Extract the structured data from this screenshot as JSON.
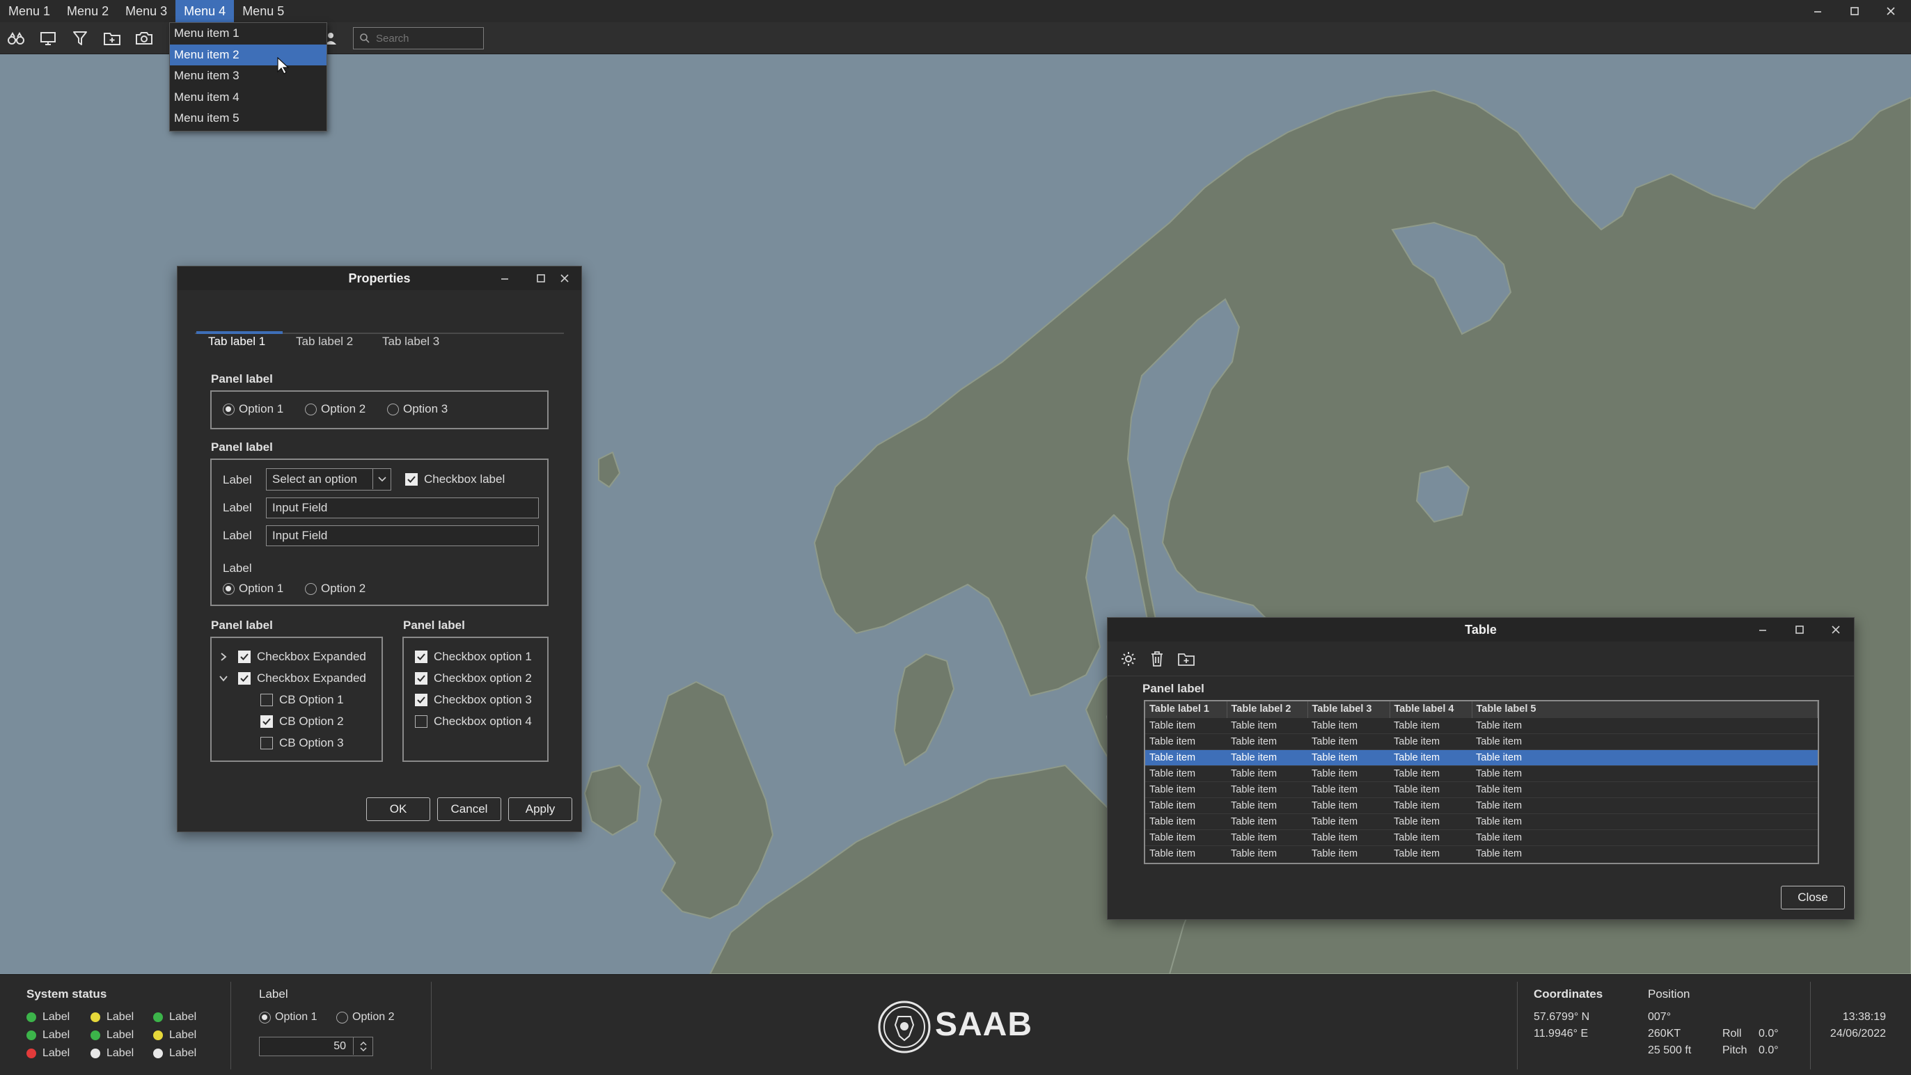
{
  "menubar": {
    "items": [
      "Menu 1",
      "Menu 2",
      "Menu 3",
      "Menu 4",
      "Menu 5"
    ],
    "active_index": 3
  },
  "toolbar": {
    "icons": [
      "binoculars-icon",
      "monitor-icon",
      "filter-icon",
      "folder-add-icon",
      "camera-icon"
    ],
    "search_placeholder": "Search"
  },
  "dropdown": {
    "items": [
      "Menu item 1",
      "Menu item 2",
      "Menu item 3",
      "Menu item 4",
      "Menu item 5"
    ],
    "highlighted_index": 1
  },
  "properties": {
    "title": "Properties",
    "tabs": [
      "Tab label 1",
      "Tab label 2",
      "Tab label 3"
    ],
    "active_tab": 0,
    "panel1": {
      "label": "Panel label",
      "options": [
        "Option 1",
        "Option 2",
        "Option 3"
      ],
      "selected": 0
    },
    "panel2": {
      "label": "Panel label",
      "row1_label": "Label",
      "select_value": "Select an option",
      "checkbox_label": "Checkbox label",
      "row2_label": "Label",
      "input1_value": "Input Field",
      "row3_label": "Label",
      "input2_value": "Input Field",
      "radio_label": "Label",
      "radio_options": [
        "Option 1",
        "Option 2"
      ],
      "radio_selected": 0
    },
    "panel3": {
      "label": "Panel label",
      "tree": [
        {
          "label": "Checkbox Expanded",
          "checked": true,
          "expanded": false
        },
        {
          "label": "Checkbox Expanded",
          "checked": true,
          "expanded": true
        }
      ],
      "children": [
        {
          "label": "CB Option 1",
          "checked": false
        },
        {
          "label": "CB Option 2",
          "checked": true
        },
        {
          "label": "CB Option 3",
          "checked": false
        }
      ]
    },
    "panel4": {
      "label": "Panel label",
      "options": [
        {
          "label": "Checkbox option 1",
          "checked": true
        },
        {
          "label": "Checkbox option 2",
          "checked": true
        },
        {
          "label": "Checkbox option 3",
          "checked": true
        },
        {
          "label": "Checkbox option 4",
          "checked": false
        }
      ]
    },
    "buttons": {
      "ok": "OK",
      "cancel": "Cancel",
      "apply": "Apply"
    }
  },
  "table_window": {
    "title": "Table",
    "panel_label": "Panel label",
    "columns": [
      "Table label 1",
      "Table label 2",
      "Table label 3",
      "Table label 4",
      "Table label 5"
    ],
    "rows": [
      [
        "Table item",
        "Table item",
        "Table item",
        "Table item",
        "Table item"
      ],
      [
        "Table item",
        "Table item",
        "Table item",
        "Table item",
        "Table item"
      ],
      [
        "Table item",
        "Table item",
        "Table item",
        "Table item",
        "Table item"
      ],
      [
        "Table item",
        "Table item",
        "Table item",
        "Table item",
        "Table item"
      ],
      [
        "Table item",
        "Table item",
        "Table item",
        "Table item",
        "Table item"
      ],
      [
        "Table item",
        "Table item",
        "Table item",
        "Table item",
        "Table item"
      ],
      [
        "Table item",
        "Table item",
        "Table item",
        "Table item",
        "Table item"
      ],
      [
        "Table item",
        "Table item",
        "Table item",
        "Table item",
        "Table item"
      ],
      [
        "Table item",
        "Table item",
        "Table item",
        "Table item",
        "Table item"
      ]
    ],
    "selected_row": 2,
    "close_label": "Close"
  },
  "statusbar": {
    "system_status_title": "System status",
    "status_items": [
      {
        "label": "Label",
        "color": "#3cb44a"
      },
      {
        "label": "Label",
        "color": "#3cb44a"
      },
      {
        "label": "Label",
        "color": "#e23a3a"
      },
      {
        "label": "Label",
        "color": "#e6d83a"
      },
      {
        "label": "Label",
        "color": "#3cb44a"
      },
      {
        "label": "Label",
        "color": "#e8e8e8"
      },
      {
        "label": "Label",
        "color": "#3cb44a"
      },
      {
        "label": "Label",
        "color": "#e6d83a"
      },
      {
        "label": "Label",
        "color": "#e8e8e8"
      }
    ],
    "control_label": "Label",
    "radio_options": [
      "Option 1",
      "Option 2"
    ],
    "radio_selected": 0,
    "spinner_value": "50",
    "logo_text": "SAAB",
    "coordinates_title": "Coordinates",
    "latitude": "57.6799° N",
    "longitude": "11.9946° E",
    "position_title": "Position",
    "heading": "007°",
    "speed": "260KT",
    "altitude": "25 500 ft",
    "roll_label": "Roll",
    "roll_value": "0.0°",
    "pitch_label": "Pitch",
    "pitch_value": "0.0°",
    "time": "13:38:19",
    "date": "24/06/2022"
  },
  "colors": {
    "accent": "#3e6fb8",
    "sea": "#7a8d9b",
    "land": "#707a6b",
    "chrome": "#2a2a2a"
  }
}
